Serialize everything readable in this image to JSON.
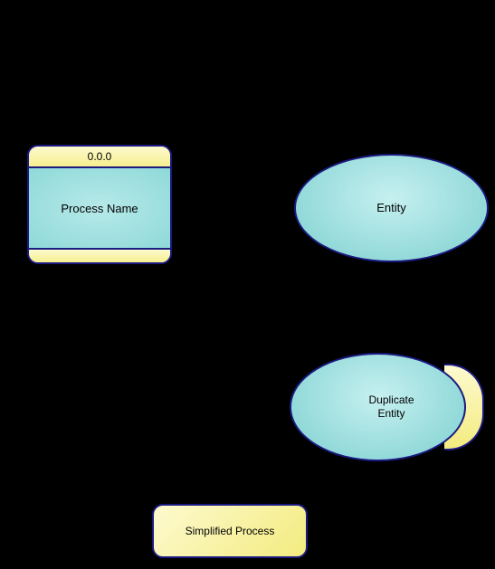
{
  "process": {
    "id_label": "0.0.0",
    "name": "Process Name"
  },
  "entity": {
    "label": "Entity"
  },
  "duplicate_entity": {
    "label_line1": "Duplicate",
    "label_line2": "Entity"
  },
  "simplified_process": {
    "label": "Simplified Process"
  },
  "colors": {
    "stroke": "#1a1a80",
    "yellow": "#f6ef8f",
    "teal": "#8fd9d9"
  }
}
